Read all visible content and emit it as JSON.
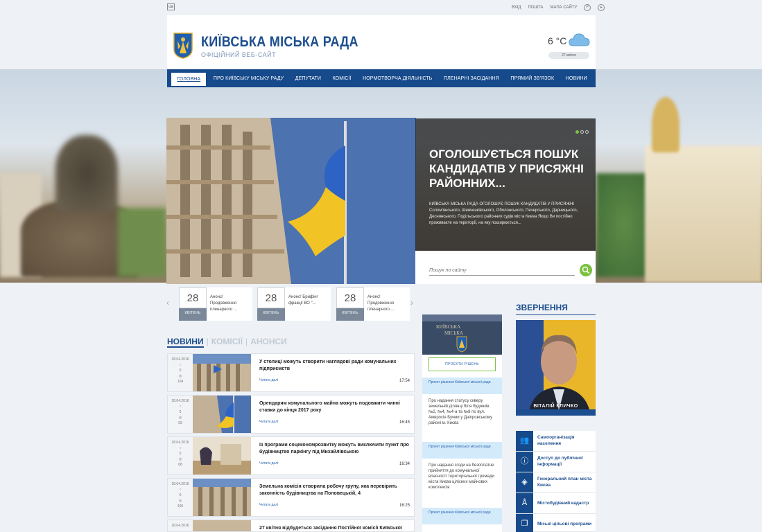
{
  "utility": {
    "lang": "ua",
    "login": "вхід",
    "mail": "пошта",
    "sitemap": "мапа сайту"
  },
  "header": {
    "title": "КИЇВСЬКА МІСЬКА РАДА",
    "subtitle": "ОФІЦІЙНИЙ ВЕБ-САЙТ",
    "temperature": "6 °C",
    "date": "27 квітня"
  },
  "nav": [
    "ГОЛОВНА",
    "ПРО КИЇВСЬКУ МІСЬКУ РАДУ",
    "ДЕПУТАТИ",
    "КОМІСІЇ",
    "НОРМОТВОРЧА ДІЯЛЬНІСТЬ",
    "ПЛЕНАРНІ ЗАСІДАННЯ",
    "ПРЯМИЙ ЗВ'ЯЗОК",
    "НОВИНИ"
  ],
  "slider": {
    "title": "ОГОЛОШУЄТЬСЯ ПОШУК КАНДИДАТІВ У ПРИСЯЖНІ РАЙОННИХ...",
    "text": "КИЇВСЬКА МІСЬКА РАДА ОГОЛОШУЄ ПОШУК КАНДИДАТІВ У ПРИСЯЖНІ Солом'янського, Шевченківського, Оболонського, Печерського, Дарницького, Деснянського, Подільського районних судів міста Києва  Якщо Ви постійно проживаєте на території, на яку поширюється..."
  },
  "search": {
    "placeholder": "Пошук по сайту"
  },
  "announcements": [
    {
      "day": "28",
      "month": "КВІТЕНЬ",
      "text": "Анонс! Продовження пленарного ..."
    },
    {
      "day": "28",
      "month": "КВІТЕНЬ",
      "text": "Анонс! Брифінг фракції ВО \"..."
    },
    {
      "day": "28",
      "month": "КВІТЕНЬ",
      "text": "Анонс! Продовження пленарного ..."
    }
  ],
  "tabs": {
    "news": "НОВИНИ",
    "commissions": "КОМІСІЇ",
    "announcements": "АНОНСИ",
    "sep": "|"
  },
  "news": [
    {
      "date": "28.04.2016",
      "comments": "0",
      "views": "104",
      "title": "У столиці можуть створити наглядові ради комунальних підприємств",
      "more": "Читати далі",
      "time": "17:54"
    },
    {
      "date": "28.04.2016",
      "comments": "0",
      "views": "59",
      "title": "Орендарям комунального майна можуть подовжити чинні ставки до кінця 2017 року",
      "more": "Читати далі",
      "time": "16:45"
    },
    {
      "date": "28.04.2016",
      "comments": "0",
      "views": "68",
      "title": "Із програми соцекономрозвитку можуть виключити пункт про будівництво паркінгу під Михайлівською",
      "more": "Читати далі",
      "time": "16:34"
    },
    {
      "date": "28.04.2016",
      "comments": "0",
      "views": "106",
      "title": "Земельна комісія створила робочу групу, яка перевірить законність будівництва на Половецькій, 4",
      "more": "Читати далі",
      "time": "16:25"
    },
    {
      "date": "28.04.2016",
      "comments": "",
      "views": "",
      "title": "27 квітня відбудеться засідання Постійної комісії Київської",
      "more": "",
      "time": ""
    }
  ],
  "projects": {
    "button": "ПРОЕКТИ РІШЕНЬ",
    "items": [
      {
        "label": "Проект рішення Київської міської ради",
        "text": "Про надання статусу скверу земельній ділянці біля будинків №2, №4, №4-а та №8 по вул. Амвросія Бучми у Дніпровському районі м. Києва"
      },
      {
        "label": "Проект рішення Київської міської ради",
        "text": "Про надання згоди на безоплатне прийняття до комунальної власності територіальної громади міста Києва цілісних майнових комплексів"
      },
      {
        "label": "Проект рішення Київської міської ради",
        "text": ""
      }
    ]
  },
  "appeals": {
    "heading": "ЗВЕРНЕННЯ",
    "mayor_name": "ВІТАЛІЙ КЛИЧКО"
  },
  "side_links": [
    {
      "icon": "people-icon",
      "label": "Самоорганізація населення"
    },
    {
      "icon": "info-icon",
      "label": "Доступ до публічної інформації"
    },
    {
      "icon": "map-plan-icon",
      "label": "Генеральний план міста Києва"
    },
    {
      "icon": "compass-icon",
      "label": "Містобудівний кадастр"
    },
    {
      "icon": "documents-icon",
      "label": "Міські цільові програми"
    }
  ],
  "colors": {
    "primary": "#164a8b",
    "accent": "#7cc242",
    "light": "#d3eafa"
  }
}
